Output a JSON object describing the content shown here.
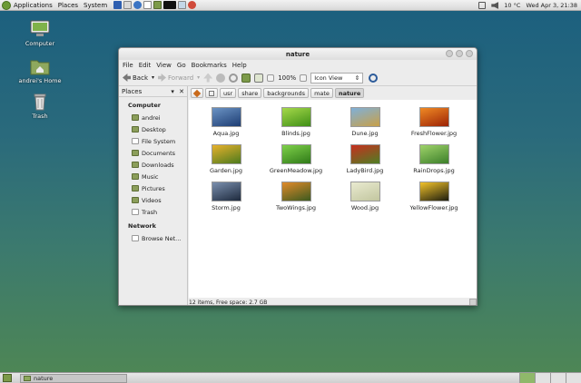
{
  "top_panel": {
    "menus": [
      "Applications",
      "Places",
      "System"
    ],
    "temperature": "10 °C",
    "datetime": "Wed Apr 3, 21:38"
  },
  "desktop_icons": [
    {
      "label": "Computer",
      "icon": "computer-icon"
    },
    {
      "label": "andrei's Home",
      "icon": "home-folder-icon"
    },
    {
      "label": "Trash",
      "icon": "trash-icon"
    }
  ],
  "window": {
    "title": "nature",
    "menu": [
      "File",
      "Edit",
      "View",
      "Go",
      "Bookmarks",
      "Help"
    ],
    "toolbar": {
      "back": "Back",
      "forward": "Forward",
      "zoom": "100%",
      "view_mode": "Icon View"
    },
    "sidebar": {
      "header": "Places",
      "computer_section": "Computer",
      "computer_items": [
        "andrei",
        "Desktop",
        "File System",
        "Documents",
        "Downloads",
        "Music",
        "Pictures",
        "Videos",
        "Trash"
      ],
      "network_section": "Network",
      "network_items": [
        "Browse Net..."
      ]
    },
    "path": [
      "usr",
      "share",
      "backgrounds",
      "mate",
      "nature"
    ],
    "files": [
      {
        "name": "Aqua.jpg",
        "c1": "#6b93c4",
        "c2": "#1d3d73"
      },
      {
        "name": "Blinds.jpg",
        "c1": "#a6d94a",
        "c2": "#3f8f16"
      },
      {
        "name": "Dune.jpg",
        "c1": "#7fb0d9",
        "c2": "#c9a047"
      },
      {
        "name": "FreshFlower.jpg",
        "c1": "#f08a24",
        "c2": "#9c2306"
      },
      {
        "name": "Garden.jpg",
        "c1": "#e7b12c",
        "c2": "#4c7a1d"
      },
      {
        "name": "GreenMeadow.jpg",
        "c1": "#7fd14a",
        "c2": "#2f7a18"
      },
      {
        "name": "LadyBird.jpg",
        "c1": "#c72f1f",
        "c2": "#4e7f24"
      },
      {
        "name": "RainDrops.jpg",
        "c1": "#9fd36a",
        "c2": "#3c7f2a"
      },
      {
        "name": "Storm.jpg",
        "c1": "#7a8fae",
        "c2": "#1e2a3d"
      },
      {
        "name": "TwoWings.jpg",
        "c1": "#e08a2a",
        "c2": "#3c5a1f"
      },
      {
        "name": "Wood.jpg",
        "c1": "#e9ead0",
        "c2": "#c2c69f"
      },
      {
        "name": "YellowFlower.jpg",
        "c1": "#f2c22a",
        "c2": "#1d1d0f"
      }
    ],
    "status": "12 items, Free space: 2.7 GB"
  },
  "bottom_panel": {
    "task": "nature"
  }
}
